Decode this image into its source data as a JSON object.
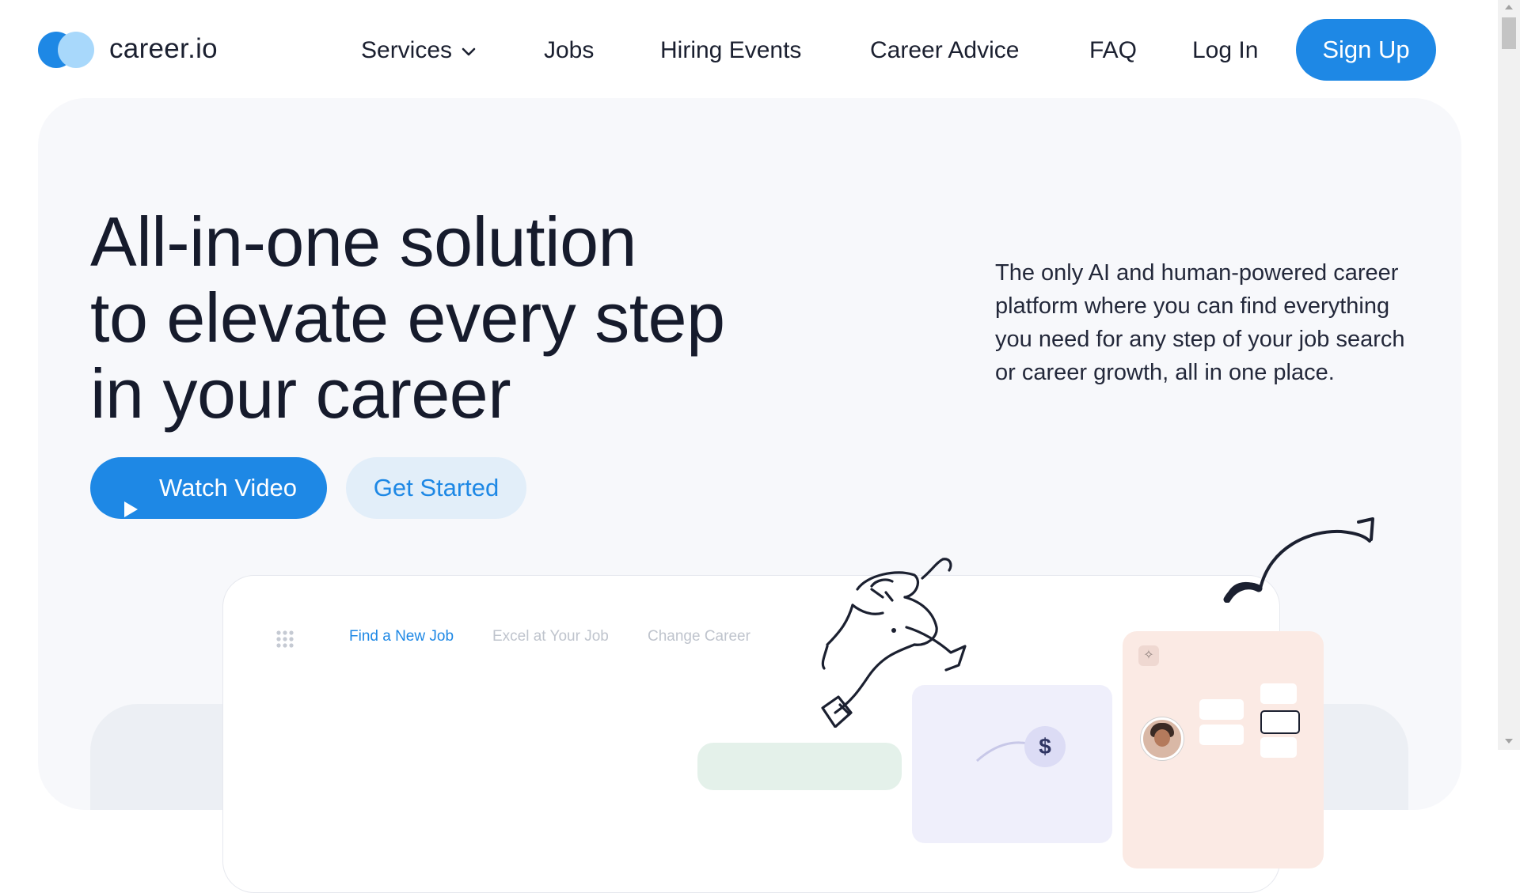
{
  "brand": {
    "name": "career.io",
    "primary_color": "#1e88e5",
    "light_color": "#a8d8fb"
  },
  "nav": {
    "items": [
      {
        "label": "Services",
        "has_dropdown": true
      },
      {
        "label": "Jobs"
      },
      {
        "label": "Hiring Events"
      },
      {
        "label": "Career Advice"
      },
      {
        "label": "FAQ"
      },
      {
        "label": "Log In"
      }
    ],
    "cta": "Sign Up"
  },
  "hero": {
    "title_lines": [
      "All-in-one solution",
      "to elevate every step",
      "in your career"
    ],
    "description": "The only AI and human-powered career platform where you can find everything you need for any step of your job search or career growth, all in one place.",
    "primary_button": "Watch Video",
    "secondary_button": "Get Started"
  },
  "mockup": {
    "tabs": [
      {
        "label": "Find a New Job",
        "active": true
      },
      {
        "label": "Excel at Your Job",
        "active": false
      },
      {
        "label": "Change Career",
        "active": false
      }
    ],
    "badge_symbol": "$"
  },
  "icons": [
    "logo-icon",
    "chevron-down-icon",
    "play-icon",
    "grid-dots-icon",
    "sparkle-icon",
    "dollar-icon",
    "arrow-doodle-icon"
  ]
}
